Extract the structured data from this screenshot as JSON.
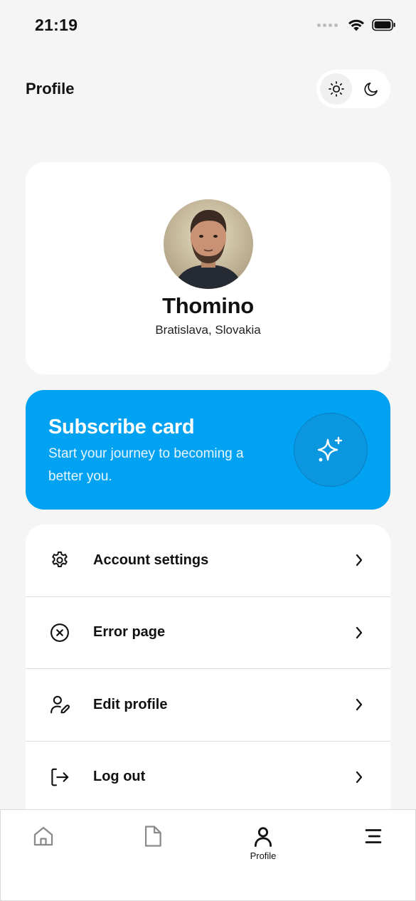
{
  "status_bar": {
    "time": "21:19"
  },
  "header": {
    "title": "Profile"
  },
  "theme_toggle": {
    "active": "light"
  },
  "profile": {
    "name": "Thomino",
    "location": "Bratislava, Slovakia"
  },
  "subscribe": {
    "title": "Subscribe card",
    "description": "Start your journey to becoming a better you.",
    "icon": "sparkles-icon",
    "background_color": "#02a2f2"
  },
  "menu": {
    "items": [
      {
        "label": "Account settings",
        "icon": "gear-icon"
      },
      {
        "label": "Error page",
        "icon": "x-circle-icon"
      },
      {
        "label": "Edit profile",
        "icon": "user-edit-icon"
      },
      {
        "label": "Log out",
        "icon": "logout-icon"
      }
    ]
  },
  "bottom_nav": {
    "items": [
      {
        "icon": "home-icon",
        "label": ""
      },
      {
        "icon": "document-icon",
        "label": ""
      },
      {
        "icon": "user-icon",
        "label": "Profile",
        "active": true
      },
      {
        "icon": "menu-icon",
        "label": ""
      }
    ]
  }
}
